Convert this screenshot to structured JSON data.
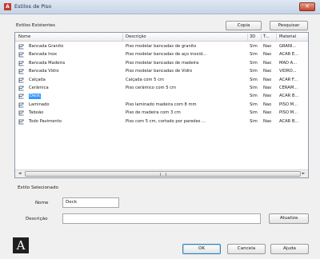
{
  "window": {
    "title": "Estilos de Piso",
    "app_icon": "A",
    "close_symbol": "✕"
  },
  "existing": {
    "label": "Estilos Existentes",
    "copy_button": "Copia",
    "search_button": "Pesquisar"
  },
  "list": {
    "columns": [
      "Nome",
      "Descrição",
      "3D",
      "T...",
      "Material"
    ],
    "rows": [
      [
        "Bancada Granito",
        "Piso modelar bancadas de granito",
        "Sim",
        "Nao",
        "GRANI..."
      ],
      [
        "Bancada Inox",
        "Piso modelar bancadas de aço inoxid...",
        "Sim",
        "Nao",
        "ACAR E..."
      ],
      [
        "Bancada Madeira",
        "Piso modelar bancadas de madeira",
        "Sim",
        "Nao",
        "MAD A..."
      ],
      [
        "Bancada Vidro",
        "Piso modelar bancadas de Vidro",
        "Sim",
        "Nao",
        "VIDRO..."
      ],
      [
        "Calçada",
        "Calçada com 5 cm",
        "Sim",
        "Nao",
        "ACAR F..."
      ],
      [
        "Cerâmica",
        "Piso cerâmico com 5 cm",
        "Sim",
        "Nao",
        "CERAM..."
      ],
      [
        "Deck",
        "",
        "Sim",
        "Nao",
        "ACAR B..."
      ],
      [
        "Laminado",
        "Piso laminado madeira com 8 mm",
        "Sim",
        "Nao",
        "PISO M..."
      ],
      [
        "Taboão",
        "Piso de madeira com 3 cm",
        "Sim",
        "Nao",
        "PISO M..."
      ],
      [
        "Todo Pavimento",
        "Piso com 5 cm, cortado por paredes ...",
        "Sim",
        "Nao",
        "ACAR B..."
      ]
    ],
    "selected_index": 6,
    "scroll_left": "◄",
    "scroll_right": "►"
  },
  "selected": {
    "label": "Estilo Selecionado",
    "name_label": "Nome",
    "name_value": "Deck",
    "desc_label": "Descrição",
    "desc_value": "",
    "update_button": "Atualiza"
  },
  "footer": {
    "ok_button": "OK",
    "cancel_button": "Cancela",
    "help_button": "Ajuda",
    "logo": "A"
  },
  "colors": {
    "selection": "#3399ff",
    "title_bar": "#c6d4e6",
    "close_button": "#c8452a"
  },
  "icons": {
    "row_icon": "floor-style-icon",
    "close": "close-icon"
  }
}
